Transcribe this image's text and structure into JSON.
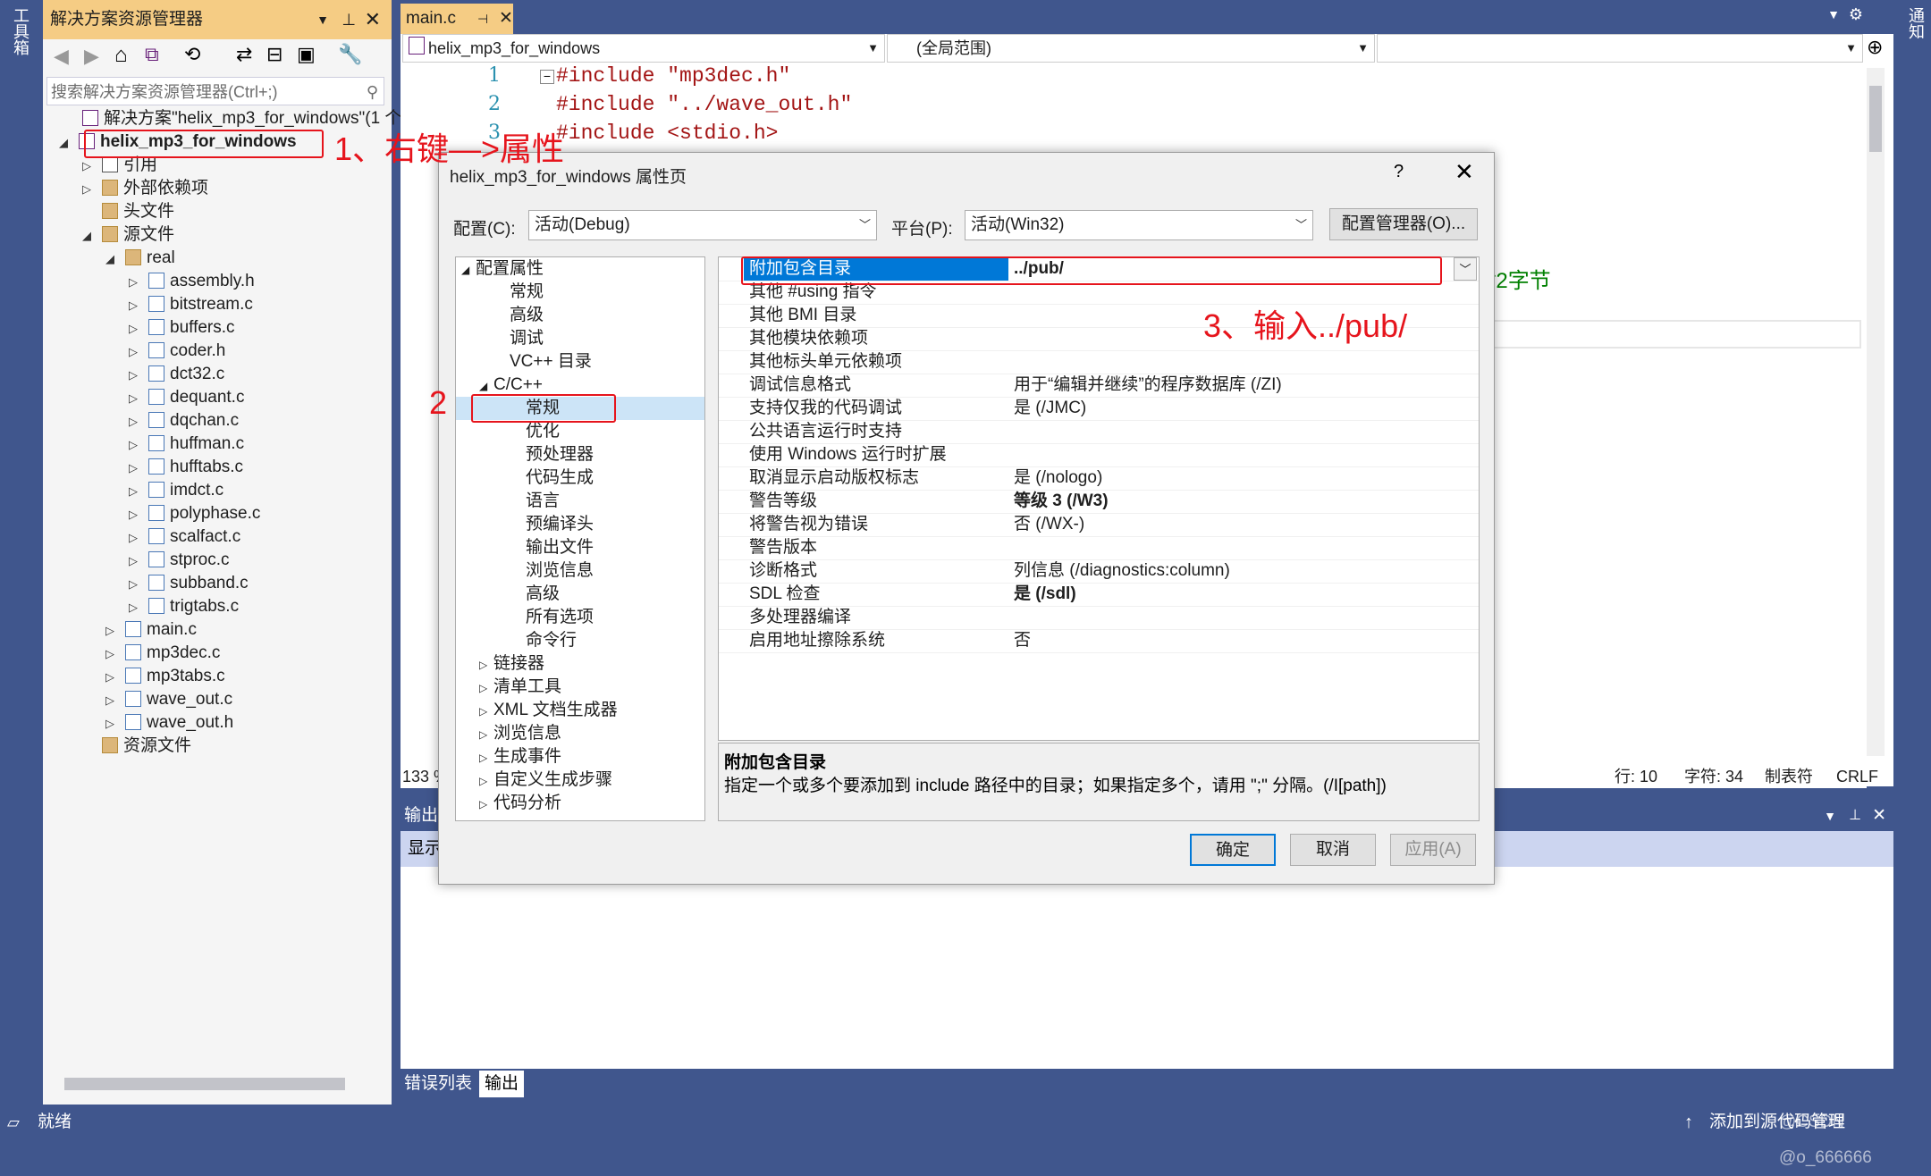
{
  "left_strip": {
    "label": "工具箱"
  },
  "right_strip": {
    "label": "通知"
  },
  "solution_explorer": {
    "title": "解决方案资源管理器",
    "search_placeholder": "搜索解决方案资源管理器(Ctrl+;)",
    "solution_label": "解决方案\"helix_mp3_for_windows\"(1 个)",
    "project_label": "helix_mp3_for_windows",
    "nodes": {
      "refs": "引用",
      "ext_deps": "外部依赖项",
      "headers": "头文件",
      "sources": "源文件",
      "real": "real",
      "resources": "资源文件"
    },
    "real_files": [
      "assembly.h",
      "bitstream.c",
      "buffers.c",
      "coder.h",
      "dct32.c",
      "dequant.c",
      "dqchan.c",
      "huffman.c",
      "hufftabs.c",
      "imdct.c",
      "polyphase.c",
      "scalfact.c",
      "stproc.c",
      "subband.c",
      "trigtabs.c"
    ],
    "src_files": [
      "main.c",
      "mp3dec.c",
      "mp3tabs.c",
      "wave_out.c",
      "wave_out.h"
    ]
  },
  "editor": {
    "tab_label": "main.c",
    "nav_project": "helix_mp3_for_windows",
    "nav_scope": "(全局范围)",
    "lines": [
      {
        "num": "1",
        "code": "#include \"mp3dec.h\""
      },
      {
        "num": "2",
        "code": "#include \"../wave_out.h\""
      },
      {
        "num": "3",
        "code": "#include <stdio.h>"
      }
    ],
    "partial_comment": "*2字节",
    "zoom_partial": "133 %",
    "status_line": "行: 10",
    "status_char": "字符: 34",
    "status_tab": "制表符",
    "status_eol": "CRLF"
  },
  "output_panel": {
    "title": "输出",
    "show_label": "显示",
    "tabs": [
      "错误列表",
      "输出"
    ]
  },
  "dialog": {
    "title": "helix_mp3_for_windows 属性页",
    "help": "?",
    "config_label": "配置(C):",
    "config_value": "活动(Debug)",
    "platform_label": "平台(P):",
    "platform_value": "活动(Win32)",
    "config_mgr": "配置管理器(O)...",
    "tree": {
      "root": "配置属性",
      "items1": [
        "常规",
        "高级",
        "调试",
        "VC++ 目录"
      ],
      "cpp": "C/C++",
      "cpp_items": [
        "常规",
        "优化",
        "预处理器",
        "代码生成",
        "语言",
        "预编译头",
        "输出文件",
        "浏览信息",
        "高级",
        "所有选项",
        "命令行"
      ],
      "items2": [
        "链接器",
        "清单工具",
        "XML 文档生成器",
        "浏览信息",
        "生成事件",
        "自定义生成步骤",
        "代码分析"
      ]
    },
    "props": [
      {
        "k": "附加包含目录",
        "v": "../pub/"
      },
      {
        "k": "其他 #using 指令",
        "v": ""
      },
      {
        "k": "其他 BMI 目录",
        "v": ""
      },
      {
        "k": "其他模块依赖项",
        "v": ""
      },
      {
        "k": "其他标头单元依赖项",
        "v": ""
      },
      {
        "k": "调试信息格式",
        "v": "用于“编辑并继续”的程序数据库 (/ZI)"
      },
      {
        "k": "支持仅我的代码调试",
        "v": "是 (/JMC)"
      },
      {
        "k": "公共语言运行时支持",
        "v": ""
      },
      {
        "k": "使用 Windows 运行时扩展",
        "v": ""
      },
      {
        "k": "取消显示启动版权标志",
        "v": "是 (/nologo)"
      },
      {
        "k": "警告等级",
        "v": "等级 3 (/W3)",
        "bold": true
      },
      {
        "k": "将警告视为错误",
        "v": "否 (/WX-)"
      },
      {
        "k": "警告版本",
        "v": ""
      },
      {
        "k": "诊断格式",
        "v": "列信息 (/diagnostics:column)"
      },
      {
        "k": "SDL 检查",
        "v": "是 (/sdl)",
        "bold": true
      },
      {
        "k": "多处理器编译",
        "v": ""
      },
      {
        "k": "启用地址擦除系统",
        "v": "否"
      }
    ],
    "desc_title": "附加包含目录",
    "desc_text": "指定一个或多个要添加到 include 路径中的目录；如果指定多个，请用 \";\" 分隔。(/I[path])",
    "ok": "确定",
    "cancel": "取消",
    "apply": "应用(A)"
  },
  "annotations": {
    "step1": "1、右键—>属性",
    "step2": "2",
    "step3": "3、输入../pub/"
  },
  "statusbar": {
    "ready": "就绪",
    "source_control": "添加到源代码管理",
    "watermark": "@CSDN @o_666666"
  },
  "colors": {
    "accent": "#40568d",
    "tab_active": "#f5cc84",
    "select": "#0078d7",
    "annotation": "#e6141c"
  }
}
